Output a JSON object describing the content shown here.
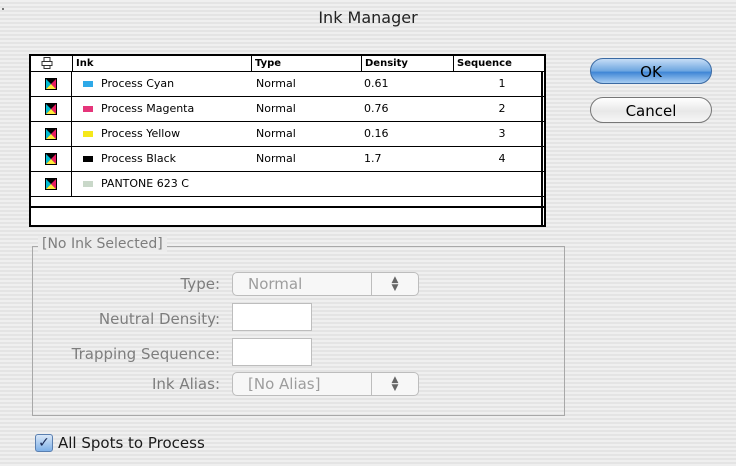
{
  "window": {
    "title": "Ink Manager"
  },
  "table": {
    "headers": [
      "",
      "Ink",
      "Type",
      "Density",
      "Sequence"
    ],
    "rows": [
      {
        "name": "Process  Cyan",
        "type": "Normal",
        "density": "0.61",
        "sequence": "1",
        "swatch": "#2ea9e8"
      },
      {
        "name": "Process  Magenta",
        "type": "Normal",
        "density": "0.76",
        "sequence": "2",
        "swatch": "#e5357a"
      },
      {
        "name": "Process  Yellow",
        "type": "Normal",
        "density": "0.16",
        "sequence": "3",
        "swatch": "#f5e81a"
      },
      {
        "name": "Process  Black",
        "type": "Normal",
        "density": "1.7",
        "sequence": "4",
        "swatch": "#000000"
      },
      {
        "name": "PANTONE 623 C",
        "type": "",
        "density": "",
        "sequence": "",
        "swatch": "#c9d8c9"
      }
    ]
  },
  "buttons": {
    "ok": "OK",
    "cancel": "Cancel"
  },
  "details": {
    "group_title": "[No Ink Selected]",
    "type_label": "Type:",
    "type_value": "Normal",
    "neutral_density_label": "Neutral Density:",
    "neutral_density_value": "",
    "trapping_sequence_label": "Trapping Sequence:",
    "trapping_sequence_value": "",
    "ink_alias_label": "Ink Alias:",
    "ink_alias_value": "[No Alias]"
  },
  "options": {
    "all_spots_label": "All Spots to Process",
    "all_spots_checked": true
  }
}
